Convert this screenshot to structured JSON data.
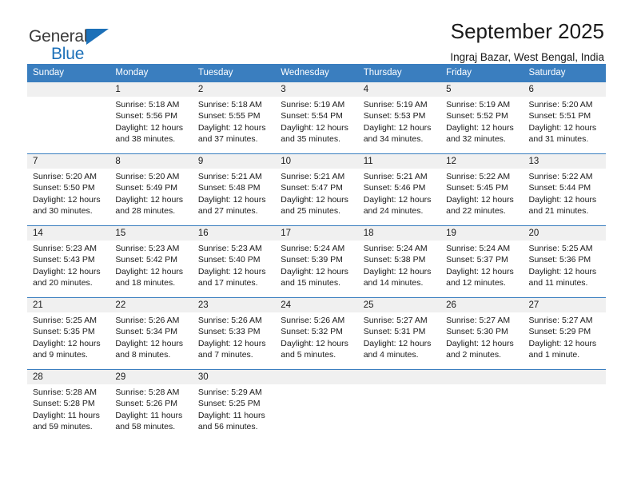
{
  "brand": {
    "line1": "General",
    "line2": "Blue",
    "triangle_color": "#1c70b8",
    "text_color": "#3b3b3b"
  },
  "header": {
    "title": "September 2025",
    "subtitle": "Ingraj Bazar, West Bengal, India"
  },
  "theme": {
    "header_bg": "#3a7ebf",
    "header_text": "#ffffff",
    "daynum_bg": "#f0f0f0",
    "page_bg": "#ffffff"
  },
  "calendar": {
    "weekday_headers": [
      "Sunday",
      "Monday",
      "Tuesday",
      "Wednesday",
      "Thursday",
      "Friday",
      "Saturday"
    ],
    "weeks": [
      [
        {
          "day": "",
          "blank": true,
          "sunrise": "",
          "sunset": "",
          "daylight1": "",
          "daylight2": ""
        },
        {
          "day": "1",
          "blank": false,
          "sunrise": "Sunrise: 5:18 AM",
          "sunset": "Sunset: 5:56 PM",
          "daylight1": "Daylight: 12 hours",
          "daylight2": "and 38 minutes."
        },
        {
          "day": "2",
          "blank": false,
          "sunrise": "Sunrise: 5:18 AM",
          "sunset": "Sunset: 5:55 PM",
          "daylight1": "Daylight: 12 hours",
          "daylight2": "and 37 minutes."
        },
        {
          "day": "3",
          "blank": false,
          "sunrise": "Sunrise: 5:19 AM",
          "sunset": "Sunset: 5:54 PM",
          "daylight1": "Daylight: 12 hours",
          "daylight2": "and 35 minutes."
        },
        {
          "day": "4",
          "blank": false,
          "sunrise": "Sunrise: 5:19 AM",
          "sunset": "Sunset: 5:53 PM",
          "daylight1": "Daylight: 12 hours",
          "daylight2": "and 34 minutes."
        },
        {
          "day": "5",
          "blank": false,
          "sunrise": "Sunrise: 5:19 AM",
          "sunset": "Sunset: 5:52 PM",
          "daylight1": "Daylight: 12 hours",
          "daylight2": "and 32 minutes."
        },
        {
          "day": "6",
          "blank": false,
          "sunrise": "Sunrise: 5:20 AM",
          "sunset": "Sunset: 5:51 PM",
          "daylight1": "Daylight: 12 hours",
          "daylight2": "and 31 minutes."
        }
      ],
      [
        {
          "day": "7",
          "blank": false,
          "sunrise": "Sunrise: 5:20 AM",
          "sunset": "Sunset: 5:50 PM",
          "daylight1": "Daylight: 12 hours",
          "daylight2": "and 30 minutes."
        },
        {
          "day": "8",
          "blank": false,
          "sunrise": "Sunrise: 5:20 AM",
          "sunset": "Sunset: 5:49 PM",
          "daylight1": "Daylight: 12 hours",
          "daylight2": "and 28 minutes."
        },
        {
          "day": "9",
          "blank": false,
          "sunrise": "Sunrise: 5:21 AM",
          "sunset": "Sunset: 5:48 PM",
          "daylight1": "Daylight: 12 hours",
          "daylight2": "and 27 minutes."
        },
        {
          "day": "10",
          "blank": false,
          "sunrise": "Sunrise: 5:21 AM",
          "sunset": "Sunset: 5:47 PM",
          "daylight1": "Daylight: 12 hours",
          "daylight2": "and 25 minutes."
        },
        {
          "day": "11",
          "blank": false,
          "sunrise": "Sunrise: 5:21 AM",
          "sunset": "Sunset: 5:46 PM",
          "daylight1": "Daylight: 12 hours",
          "daylight2": "and 24 minutes."
        },
        {
          "day": "12",
          "blank": false,
          "sunrise": "Sunrise: 5:22 AM",
          "sunset": "Sunset: 5:45 PM",
          "daylight1": "Daylight: 12 hours",
          "daylight2": "and 22 minutes."
        },
        {
          "day": "13",
          "blank": false,
          "sunrise": "Sunrise: 5:22 AM",
          "sunset": "Sunset: 5:44 PM",
          "daylight1": "Daylight: 12 hours",
          "daylight2": "and 21 minutes."
        }
      ],
      [
        {
          "day": "14",
          "blank": false,
          "sunrise": "Sunrise: 5:23 AM",
          "sunset": "Sunset: 5:43 PM",
          "daylight1": "Daylight: 12 hours",
          "daylight2": "and 20 minutes."
        },
        {
          "day": "15",
          "blank": false,
          "sunrise": "Sunrise: 5:23 AM",
          "sunset": "Sunset: 5:42 PM",
          "daylight1": "Daylight: 12 hours",
          "daylight2": "and 18 minutes."
        },
        {
          "day": "16",
          "blank": false,
          "sunrise": "Sunrise: 5:23 AM",
          "sunset": "Sunset: 5:40 PM",
          "daylight1": "Daylight: 12 hours",
          "daylight2": "and 17 minutes."
        },
        {
          "day": "17",
          "blank": false,
          "sunrise": "Sunrise: 5:24 AM",
          "sunset": "Sunset: 5:39 PM",
          "daylight1": "Daylight: 12 hours",
          "daylight2": "and 15 minutes."
        },
        {
          "day": "18",
          "blank": false,
          "sunrise": "Sunrise: 5:24 AM",
          "sunset": "Sunset: 5:38 PM",
          "daylight1": "Daylight: 12 hours",
          "daylight2": "and 14 minutes."
        },
        {
          "day": "19",
          "blank": false,
          "sunrise": "Sunrise: 5:24 AM",
          "sunset": "Sunset: 5:37 PM",
          "daylight1": "Daylight: 12 hours",
          "daylight2": "and 12 minutes."
        },
        {
          "day": "20",
          "blank": false,
          "sunrise": "Sunrise: 5:25 AM",
          "sunset": "Sunset: 5:36 PM",
          "daylight1": "Daylight: 12 hours",
          "daylight2": "and 11 minutes."
        }
      ],
      [
        {
          "day": "21",
          "blank": false,
          "sunrise": "Sunrise: 5:25 AM",
          "sunset": "Sunset: 5:35 PM",
          "daylight1": "Daylight: 12 hours",
          "daylight2": "and 9 minutes."
        },
        {
          "day": "22",
          "blank": false,
          "sunrise": "Sunrise: 5:26 AM",
          "sunset": "Sunset: 5:34 PM",
          "daylight1": "Daylight: 12 hours",
          "daylight2": "and 8 minutes."
        },
        {
          "day": "23",
          "blank": false,
          "sunrise": "Sunrise: 5:26 AM",
          "sunset": "Sunset: 5:33 PM",
          "daylight1": "Daylight: 12 hours",
          "daylight2": "and 7 minutes."
        },
        {
          "day": "24",
          "blank": false,
          "sunrise": "Sunrise: 5:26 AM",
          "sunset": "Sunset: 5:32 PM",
          "daylight1": "Daylight: 12 hours",
          "daylight2": "and 5 minutes."
        },
        {
          "day": "25",
          "blank": false,
          "sunrise": "Sunrise: 5:27 AM",
          "sunset": "Sunset: 5:31 PM",
          "daylight1": "Daylight: 12 hours",
          "daylight2": "and 4 minutes."
        },
        {
          "day": "26",
          "blank": false,
          "sunrise": "Sunrise: 5:27 AM",
          "sunset": "Sunset: 5:30 PM",
          "daylight1": "Daylight: 12 hours",
          "daylight2": "and 2 minutes."
        },
        {
          "day": "27",
          "blank": false,
          "sunrise": "Sunrise: 5:27 AM",
          "sunset": "Sunset: 5:29 PM",
          "daylight1": "Daylight: 12 hours",
          "daylight2": "and 1 minute."
        }
      ],
      [
        {
          "day": "28",
          "blank": false,
          "sunrise": "Sunrise: 5:28 AM",
          "sunset": "Sunset: 5:28 PM",
          "daylight1": "Daylight: 11 hours",
          "daylight2": "and 59 minutes."
        },
        {
          "day": "29",
          "blank": false,
          "sunrise": "Sunrise: 5:28 AM",
          "sunset": "Sunset: 5:26 PM",
          "daylight1": "Daylight: 11 hours",
          "daylight2": "and 58 minutes."
        },
        {
          "day": "30",
          "blank": false,
          "sunrise": "Sunrise: 5:29 AM",
          "sunset": "Sunset: 5:25 PM",
          "daylight1": "Daylight: 11 hours",
          "daylight2": "and 56 minutes."
        },
        {
          "day": "",
          "blank": true,
          "sunrise": "",
          "sunset": "",
          "daylight1": "",
          "daylight2": ""
        },
        {
          "day": "",
          "blank": true,
          "sunrise": "",
          "sunset": "",
          "daylight1": "",
          "daylight2": ""
        },
        {
          "day": "",
          "blank": true,
          "sunrise": "",
          "sunset": "",
          "daylight1": "",
          "daylight2": ""
        },
        {
          "day": "",
          "blank": true,
          "sunrise": "",
          "sunset": "",
          "daylight1": "",
          "daylight2": ""
        }
      ]
    ]
  }
}
